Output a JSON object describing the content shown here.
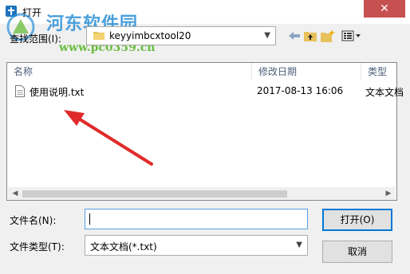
{
  "window": {
    "title": "打开",
    "close_glyph": "✕"
  },
  "watermark": {
    "site_name": "河东软件园",
    "url": "www.pc0359.cn"
  },
  "toolbar": {
    "lookin_label": "查找范围(I):",
    "lookin_value": "keyyimbcxtool20",
    "icons": [
      "back-arrow-icon",
      "up-folder-icon",
      "new-folder-icon",
      "view-menu-icon"
    ]
  },
  "filelist": {
    "columns": [
      "名称",
      "修改日期",
      "类型"
    ],
    "rows": [
      {
        "name": "使用说明.txt",
        "date": "2017-08-13 16:06",
        "type": "文本文档"
      }
    ]
  },
  "form": {
    "filename_label": "文件名(N):",
    "filename_value": "",
    "filetype_label": "文件类型(T):",
    "filetype_value": "文本文档(*.txt)",
    "open_label": "打开(O)",
    "cancel_label": "取消"
  },
  "colors": {
    "accent": "#0078d7",
    "close": "#c75050",
    "annotation": "#e02a2a"
  }
}
